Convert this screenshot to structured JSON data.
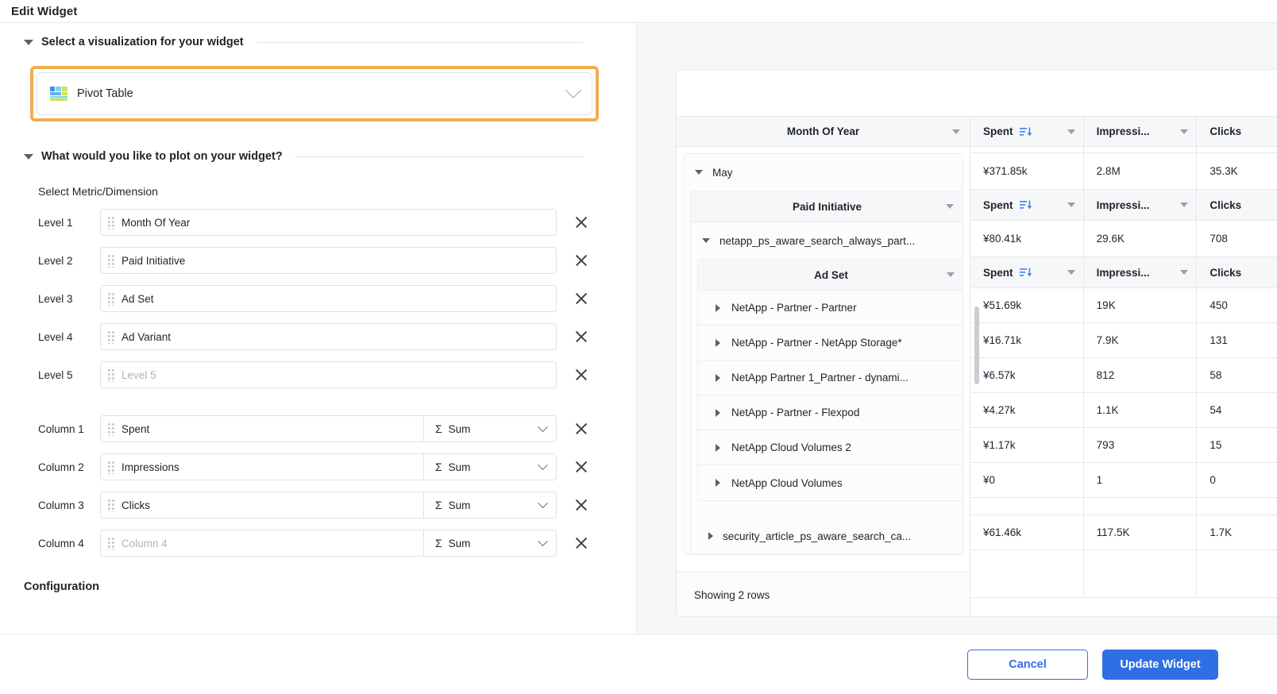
{
  "window": {
    "title": "Edit Widget"
  },
  "sections": {
    "visualization": {
      "label": "Select a visualization for your widget"
    },
    "plot": {
      "label": "What would you like to plot on your widget?"
    },
    "configuration": {
      "label": "Configuration"
    }
  },
  "visualization_select": {
    "value": "Pivot Table",
    "icon": "pivot-table-icon",
    "chevron": "chevron-down-icon"
  },
  "plot": {
    "sub_label": "Select Metric/Dimension",
    "levels": [
      {
        "label": "Level 1",
        "value": "Month Of Year",
        "placeholder": "Level 1",
        "empty": false
      },
      {
        "label": "Level 2",
        "value": "Paid Initiative",
        "placeholder": "Level 2",
        "empty": false
      },
      {
        "label": "Level 3",
        "value": "Ad Set",
        "placeholder": "Level 3",
        "empty": false
      },
      {
        "label": "Level 4",
        "value": "Ad Variant",
        "placeholder": "Level 4",
        "empty": false
      },
      {
        "label": "Level 5",
        "value": "Level 5",
        "placeholder": "Level 5",
        "empty": true
      }
    ],
    "columns": [
      {
        "label": "Column 1",
        "value": "Spent",
        "placeholder": "Column 1",
        "empty": false,
        "agg": "Sum"
      },
      {
        "label": "Column 2",
        "value": "Impressions",
        "placeholder": "Column 2",
        "empty": false,
        "agg": "Sum"
      },
      {
        "label": "Column 3",
        "value": "Clicks",
        "placeholder": "Column 3",
        "empty": false,
        "agg": "Sum"
      },
      {
        "label": "Column 4",
        "value": "Column 4",
        "placeholder": "Column 4",
        "empty": true,
        "agg": "Sum"
      }
    ],
    "agg_symbol": "Σ"
  },
  "preview": {
    "level1_header": "Month Of Year",
    "level2_header": "Paid Initiative",
    "level3_header": "Ad Set",
    "metric_headers": [
      "Spent",
      "Impressi...",
      "Clicks"
    ],
    "month_row": {
      "name": "May",
      "spent": "¥371.85k",
      "impressions": "2.8M",
      "clicks": "35.3K"
    },
    "initiative_row": {
      "name": "netapp_ps_aware_search_always_part...",
      "spent": "¥80.41k",
      "impressions": "29.6K",
      "clicks": "708"
    },
    "ad_sets": [
      {
        "name": "NetApp - Partner - Partner",
        "spent": "¥51.69k",
        "impressions": "19K",
        "clicks": "450"
      },
      {
        "name": "NetApp - Partner - NetApp Storage*",
        "spent": "¥16.71k",
        "impressions": "7.9K",
        "clicks": "131"
      },
      {
        "name": "NetApp Partner 1_Partner - dynami...",
        "spent": "¥6.57k",
        "impressions": "812",
        "clicks": "58"
      },
      {
        "name": "NetApp - Partner - Flexpod",
        "spent": "¥4.27k",
        "impressions": "1.1K",
        "clicks": "54"
      },
      {
        "name": "NetApp Cloud Volumes 2",
        "spent": "¥1.17k",
        "impressions": "793",
        "clicks": "15"
      },
      {
        "name": "NetApp Cloud Volumes",
        "spent": "¥0",
        "impressions": "1",
        "clicks": "0"
      }
    ],
    "second_initiative_row": {
      "name": "security_article_ps_aware_search_ca...",
      "spent": "¥61.46k",
      "impressions": "117.5K",
      "clicks": "1.7K"
    },
    "showing": "Showing 2 rows"
  },
  "footer": {
    "cancel_label": "Cancel",
    "update_label": "Update Widget"
  },
  "colors": {
    "accent_blue": "#2f6fe4",
    "highlight_orange": "#f0ad4e",
    "sort_blue": "#3b82f6"
  }
}
